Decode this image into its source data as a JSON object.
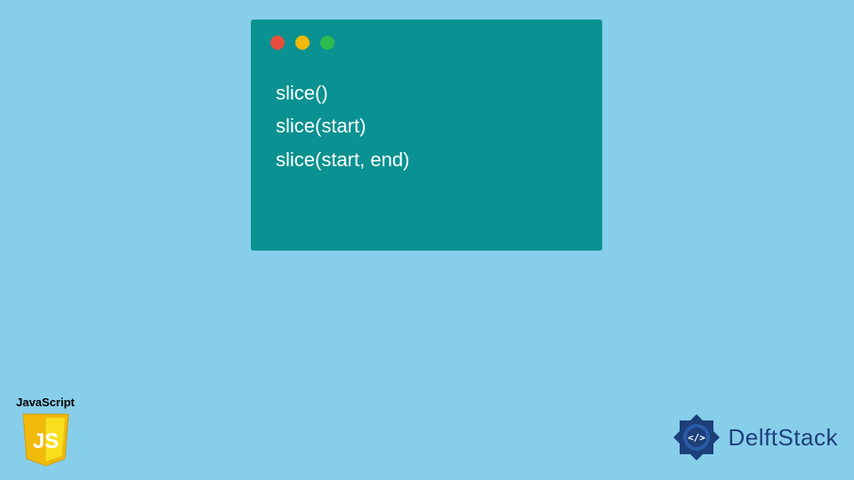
{
  "codeWindow": {
    "lines": [
      "slice()",
      "slice(start)",
      "slice(start, end)"
    ]
  },
  "jsBadge": {
    "label": "JavaScript",
    "shieldText": "JS"
  },
  "brand": {
    "name": "DelftStack"
  },
  "colors": {
    "background": "#87ceeb",
    "window": "#0a9191",
    "dotRed": "#e84d3d",
    "dotYellow": "#f0b90b",
    "dotGreen": "#2dbb4e",
    "jsYellow": "#f7df1e",
    "brandBlue": "#1d3f7a"
  }
}
